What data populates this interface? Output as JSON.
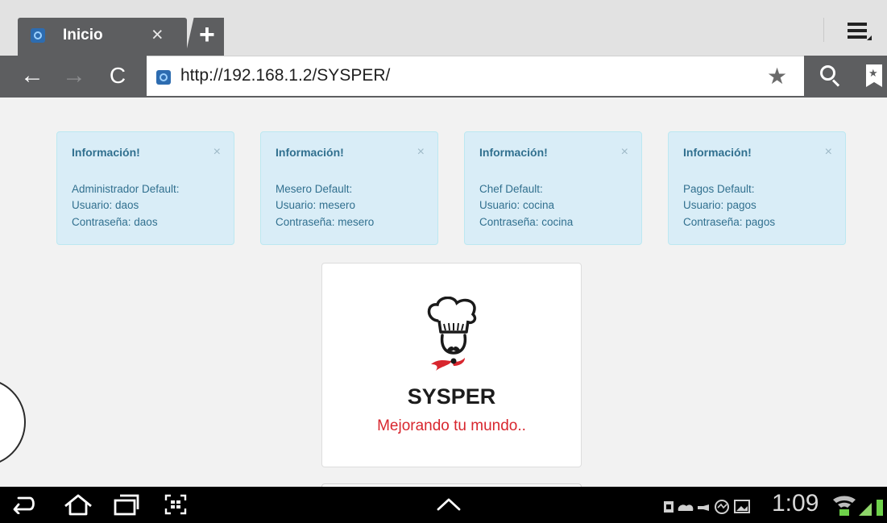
{
  "browser": {
    "tab": {
      "title": "Inicio",
      "close_glyph": "×"
    },
    "new_tab_glyph": "+",
    "toolbar": {
      "back_glyph": "←",
      "forward_glyph": "→",
      "reload_glyph": "C",
      "url": "http://192.168.1.2/SYSPER/",
      "star_glyph": "★",
      "bookmark_glyph": "★"
    }
  },
  "alerts": [
    {
      "title": "Información!",
      "close_glyph": "×",
      "line1": "Administrador Default:",
      "line2": "Usuario: daos",
      "line3": "Contraseña: daos"
    },
    {
      "title": "Información!",
      "close_glyph": "×",
      "line1": "Mesero Default:",
      "line2": "Usuario: mesero",
      "line3": "Contraseña: mesero"
    },
    {
      "title": "Información!",
      "close_glyph": "×",
      "line1": "Chef Default:",
      "line2": "Usuario: cocina",
      "line3": "Contraseña: cocina"
    },
    {
      "title": "Información!",
      "close_glyph": "×",
      "line1": "Pagos Default:",
      "line2": "Usuario: pagos",
      "line3": "Contraseña: pagos"
    }
  ],
  "logo": {
    "brand": "SYSPER",
    "slogan": "Mejorando tu mundo.."
  },
  "status_bar": {
    "time": "1:09"
  },
  "colors": {
    "alert_bg": "#d9edf7",
    "alert_text": "#31708f",
    "slogan": "#d8262e",
    "chrome_dark": "#5d5e60"
  }
}
